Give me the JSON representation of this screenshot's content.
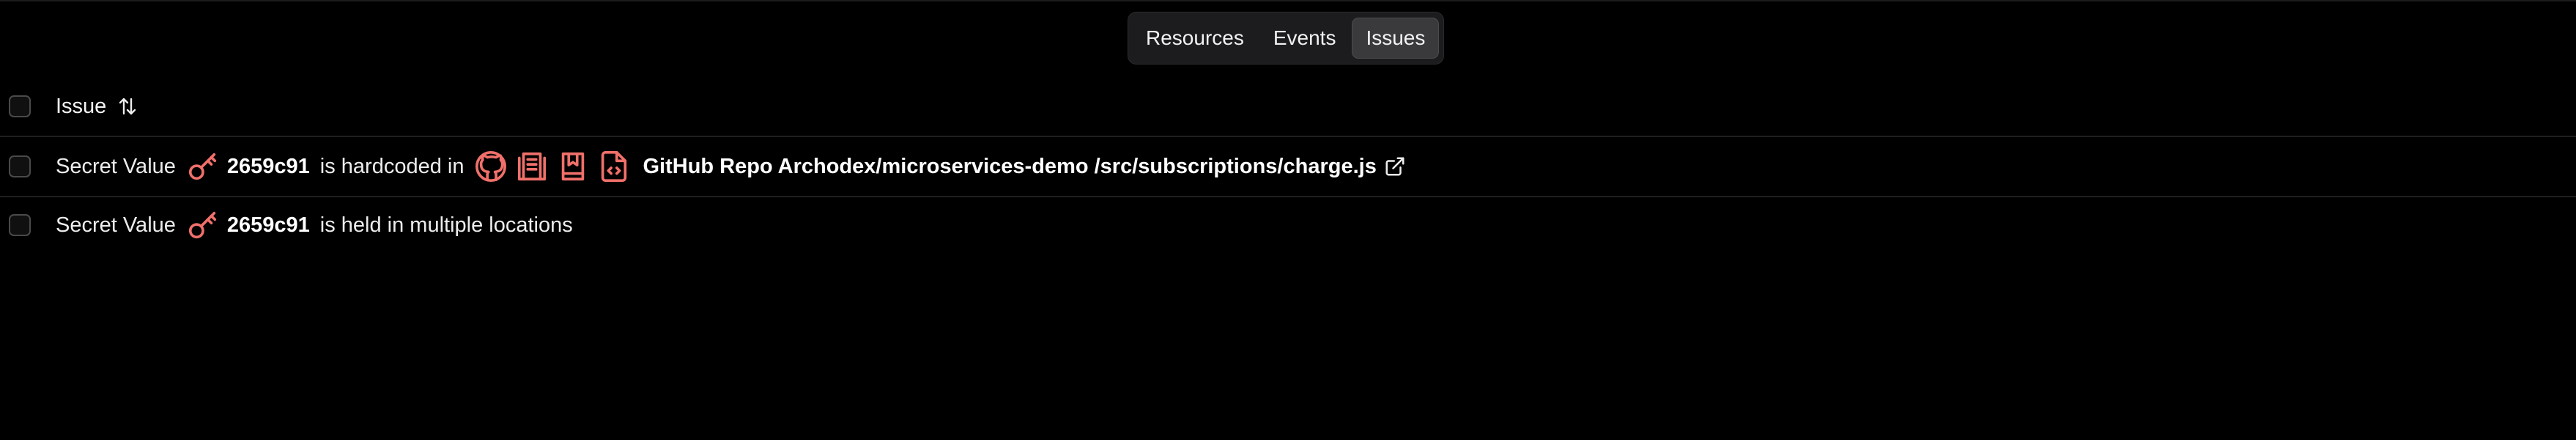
{
  "tabs": [
    {
      "label": "Resources",
      "active": false
    },
    {
      "label": "Events",
      "active": false
    },
    {
      "label": "Issues",
      "active": true
    }
  ],
  "table": {
    "header": {
      "issue_label": "Issue",
      "sort_icon": "sort-arrows-icon"
    },
    "rows": [
      {
        "type": "Secret Value",
        "icon": "key-icon",
        "hash": "2659c91",
        "description": "is hardcoded in",
        "resource_icons": [
          "github-icon",
          "repository-icon",
          "bookmark-book-icon",
          "code-file-icon"
        ],
        "resource": "GitHub Repo Archodex/microservices-demo /src/subscriptions/charge.js",
        "link_icon": "external-link-icon"
      },
      {
        "type": "Secret Value",
        "icon": "key-icon",
        "hash": "2659c91",
        "description": "is held in multiple locations"
      }
    ]
  },
  "colors": {
    "background": "#000000",
    "accent_icon": "#f0706a",
    "text": "#ededed",
    "divider": "#1f1f1f"
  }
}
